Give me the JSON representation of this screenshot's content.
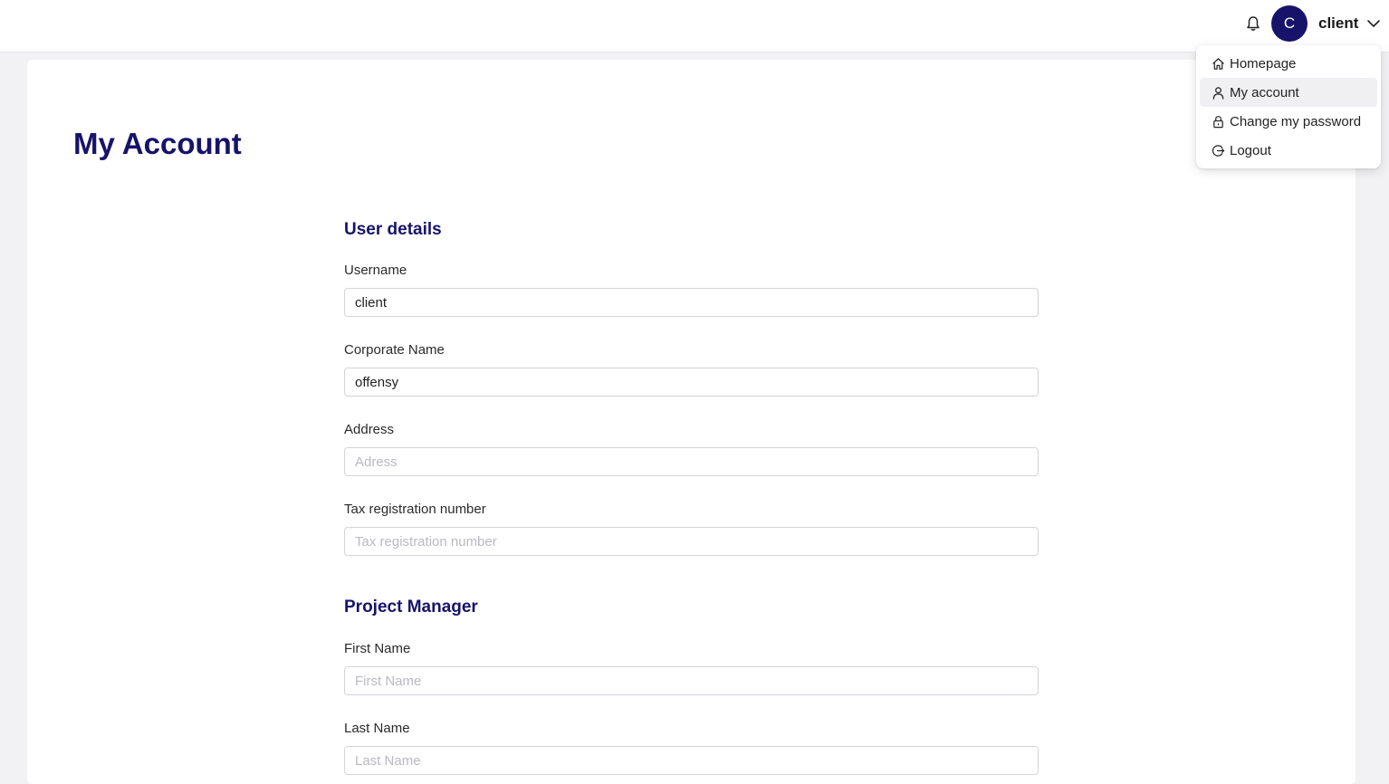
{
  "header": {
    "avatar_initial": "C",
    "username": "client"
  },
  "menu": {
    "items": [
      {
        "label": "Homepage",
        "icon": "home-icon"
      },
      {
        "label": "My account",
        "icon": "user-icon",
        "active": true
      },
      {
        "label": "Change my password",
        "icon": "lock-icon"
      },
      {
        "label": "Logout",
        "icon": "logout-icon"
      }
    ]
  },
  "page": {
    "title": "My Account"
  },
  "user_details": {
    "title": "User details",
    "username": {
      "label": "Username",
      "value": "client",
      "placeholder": ""
    },
    "corporate_name": {
      "label": "Corporate Name",
      "value": "offensy",
      "placeholder": ""
    },
    "address": {
      "label": "Address",
      "value": "",
      "placeholder": "Adress"
    },
    "tax_number": {
      "label": "Tax registration number",
      "value": "",
      "placeholder": "Tax registration number"
    }
  },
  "project_manager": {
    "title": "Project Manager",
    "first_name": {
      "label": "First Name",
      "value": "",
      "placeholder": "First Name"
    },
    "last_name": {
      "label": "Last Name",
      "value": "",
      "placeholder": "Last Name"
    }
  },
  "colors": {
    "brand": "#17136b",
    "menu_active_bg": "#f0f0f3",
    "page_bg": "#f2f2f4"
  }
}
